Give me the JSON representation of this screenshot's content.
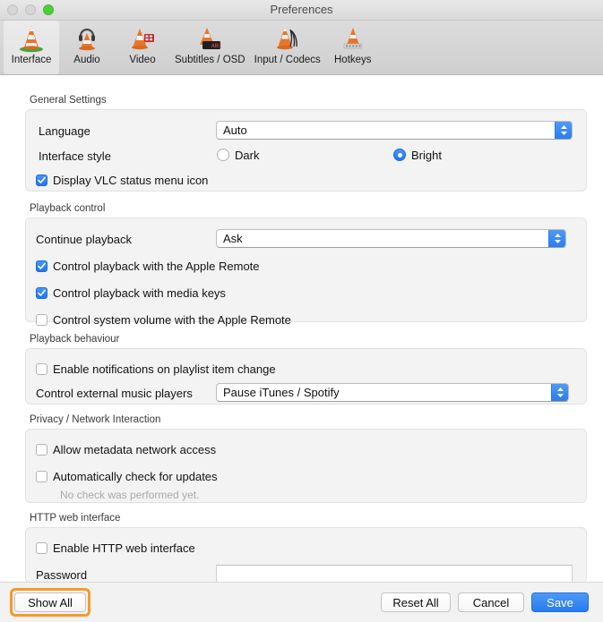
{
  "window": {
    "title": "Preferences",
    "traffic_lights": [
      "close",
      "minimize",
      "zoom"
    ]
  },
  "toolbar": {
    "items": [
      {
        "label": "Interface",
        "icon": "vlc-cone-interface-icon",
        "selected": true
      },
      {
        "label": "Audio",
        "icon": "vlc-cone-headphones-icon",
        "selected": false
      },
      {
        "label": "Video",
        "icon": "vlc-cone-film-icon",
        "selected": false
      },
      {
        "label": "Subtitles / OSD",
        "icon": "vlc-cone-subtitles-icon",
        "selected": false
      },
      {
        "label": "Input / Codecs",
        "icon": "vlc-cone-cables-icon",
        "selected": false
      },
      {
        "label": "Hotkeys",
        "icon": "vlc-cone-keyboard-icon",
        "selected": false
      }
    ]
  },
  "sections": {
    "general": {
      "legend": "General Settings",
      "language_label": "Language",
      "language_value": "Auto",
      "interface_style_label": "Interface style",
      "style_dark_label": "Dark",
      "style_dark_selected": false,
      "style_bright_label": "Bright",
      "style_bright_selected": true,
      "status_menu_label": "Display VLC status menu icon",
      "status_menu_checked": true
    },
    "playback_control": {
      "legend": "Playback control",
      "continue_label": "Continue playback",
      "continue_value": "Ask",
      "apple_remote_label": "Control playback with the Apple Remote",
      "apple_remote_checked": true,
      "media_keys_label": "Control playback with media keys",
      "media_keys_checked": true,
      "system_volume_label": "Control system volume with the Apple Remote",
      "system_volume_checked": false
    },
    "playback_behaviour": {
      "legend": "Playback behaviour",
      "notifications_label": "Enable notifications on playlist item change",
      "notifications_checked": false,
      "external_players_label": "Control external music players",
      "external_players_value": "Pause iTunes / Spotify"
    },
    "privacy": {
      "legend": "Privacy / Network Interaction",
      "metadata_label": "Allow metadata network access",
      "metadata_checked": false,
      "updates_label": "Automatically check for updates",
      "updates_checked": false,
      "update_status": "No check was performed yet."
    },
    "http": {
      "legend": "HTTP web interface",
      "enable_label": "Enable HTTP web interface",
      "enable_checked": false,
      "password_label": "Password",
      "password_value": "",
      "password_placeholder": ""
    }
  },
  "footer": {
    "show_all_label": "Show All",
    "reset_all_label": "Reset All",
    "cancel_label": "Cancel",
    "save_label": "Save"
  },
  "colors": {
    "accent_blue": "#2a7bef",
    "focus_orange": "#f79a24",
    "group_background": "#f3f3f3",
    "zoom_green": "#4cd037"
  }
}
